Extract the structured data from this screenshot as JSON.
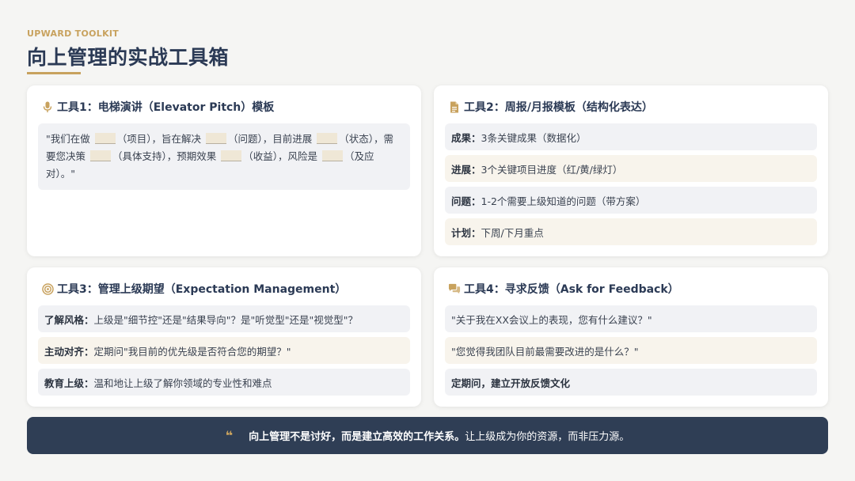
{
  "header": {
    "eyebrow": "UPWARD TOOLKIT",
    "title": "向上管理的实战工具箱"
  },
  "colors": {
    "accent": "#c8a25e",
    "navy": "#2f3e55",
    "gray_row": "#f1f2f5",
    "cream_row": "#f8f4ec"
  },
  "tool1": {
    "icon": "microphone-icon",
    "title": "工具1：电梯演讲（Elevator Pitch）模板",
    "parts": [
      "\"我们在做 ",
      "（项目），旨在解决 ",
      "（问题），目前进展 ",
      "（状态），需要您决策 ",
      "（具体支持），预期效果 ",
      "（收益），风险是 ",
      "（及应对）。\""
    ]
  },
  "tool2": {
    "icon": "document-icon",
    "title": "工具2：周报/月报模板（结构化表达）",
    "rows": [
      {
        "key": "成果：",
        "text": "3条关键成果（数据化）"
      },
      {
        "key": "进展：",
        "text": "3个关键项目进度（红/黄/绿灯）"
      },
      {
        "key": "问题：",
        "text": "1-2个需要上级知道的问题（带方案）"
      },
      {
        "key": "计划：",
        "text": "下周/下月重点"
      }
    ]
  },
  "tool3": {
    "icon": "target-icon",
    "title": "工具3：管理上级期望（Expectation Management）",
    "rows": [
      {
        "key": "了解风格：",
        "text": "上级是\"细节控\"还是\"结果导向\"？是\"听觉型\"还是\"视觉型\"？"
      },
      {
        "key": "主动对齐：",
        "text": "定期问\"我目前的优先级是否符合您的期望？\""
      },
      {
        "key": "教育上级：",
        "text": "温和地让上级了解你领域的专业性和难点"
      }
    ]
  },
  "tool4": {
    "icon": "chat-bubbles-icon",
    "title": "工具4：寻求反馈（Ask for Feedback）",
    "rows": [
      {
        "text": "\"关于我在XX会议上的表现，您有什么建议？\""
      },
      {
        "text": "\"您觉得我团队目前最需要改进的是什么？\""
      },
      {
        "text": "定期问，建立开放反馈文化"
      }
    ]
  },
  "footer": {
    "quote_mark": "❝",
    "strong": "向上管理不是讨好，而是建立高效的工作关系。",
    "rest": "让上级成为你的资源，而非压力源。"
  }
}
